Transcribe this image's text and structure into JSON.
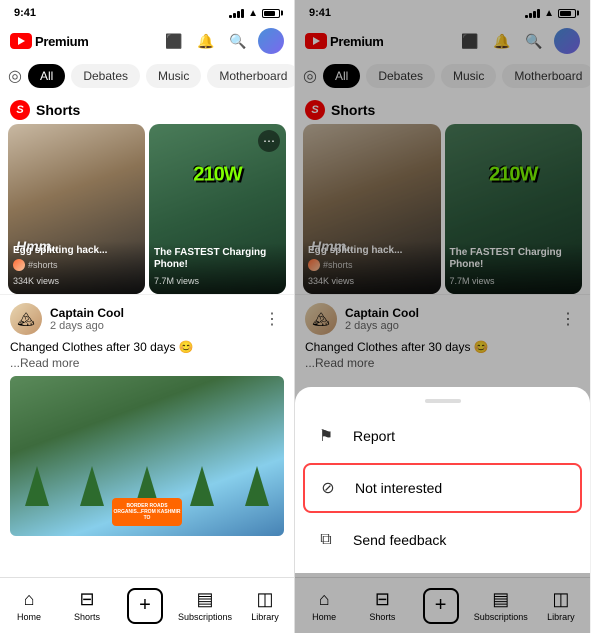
{
  "phones": {
    "left": {
      "status": {
        "time": "9:41"
      },
      "header": {
        "logo_text": "Premium"
      },
      "tabs": [
        "All",
        "Debates",
        "Music",
        "Motherboard"
      ],
      "active_tab": "All",
      "shorts": {
        "label": "Shorts",
        "cards": [
          {
            "title": "Egg splitting hack...",
            "tag": "#shorts",
            "views": "334K views",
            "hmm_text": "Hmm.."
          },
          {
            "title": "The FASTEST Charging Phone!",
            "views": "7.7M views",
            "watt_text": "210W",
            "has_three_dot": false
          }
        ]
      },
      "video": {
        "channel": "Captain Cool",
        "time": "2 days ago",
        "description": "Changed Clothes after 30 days 😊",
        "read_more": "...Read more"
      }
    },
    "right": {
      "status": {
        "time": "9:41"
      },
      "header": {
        "logo_text": "Premium"
      },
      "tabs": [
        "All",
        "Debates",
        "Music",
        "Motherboard"
      ],
      "active_tab": "All",
      "shorts": {
        "label": "Shorts",
        "cards": [
          {
            "title": "Egg splitting hack...",
            "tag": "#shorts",
            "views": "334K views",
            "hmm_text": "Hmm.."
          },
          {
            "title": "The FASTEST Charging Phone!",
            "views": "7.7M views",
            "watt_text": "210W"
          }
        ]
      },
      "video": {
        "channel": "Captain Cool",
        "time": "2 days ago",
        "description": "Changed Clothes after 30 days 😊",
        "read_more": "...Read more"
      },
      "context_menu": {
        "items": [
          {
            "icon": "⚑",
            "label": "Report"
          },
          {
            "icon": "⊘",
            "label": "Not interested",
            "highlighted": true
          },
          {
            "icon": "⧉",
            "label": "Send feedback"
          }
        ]
      }
    }
  },
  "nav": {
    "items": [
      "Home",
      "Shorts",
      "+",
      "Subscriptions",
      "Library"
    ]
  }
}
